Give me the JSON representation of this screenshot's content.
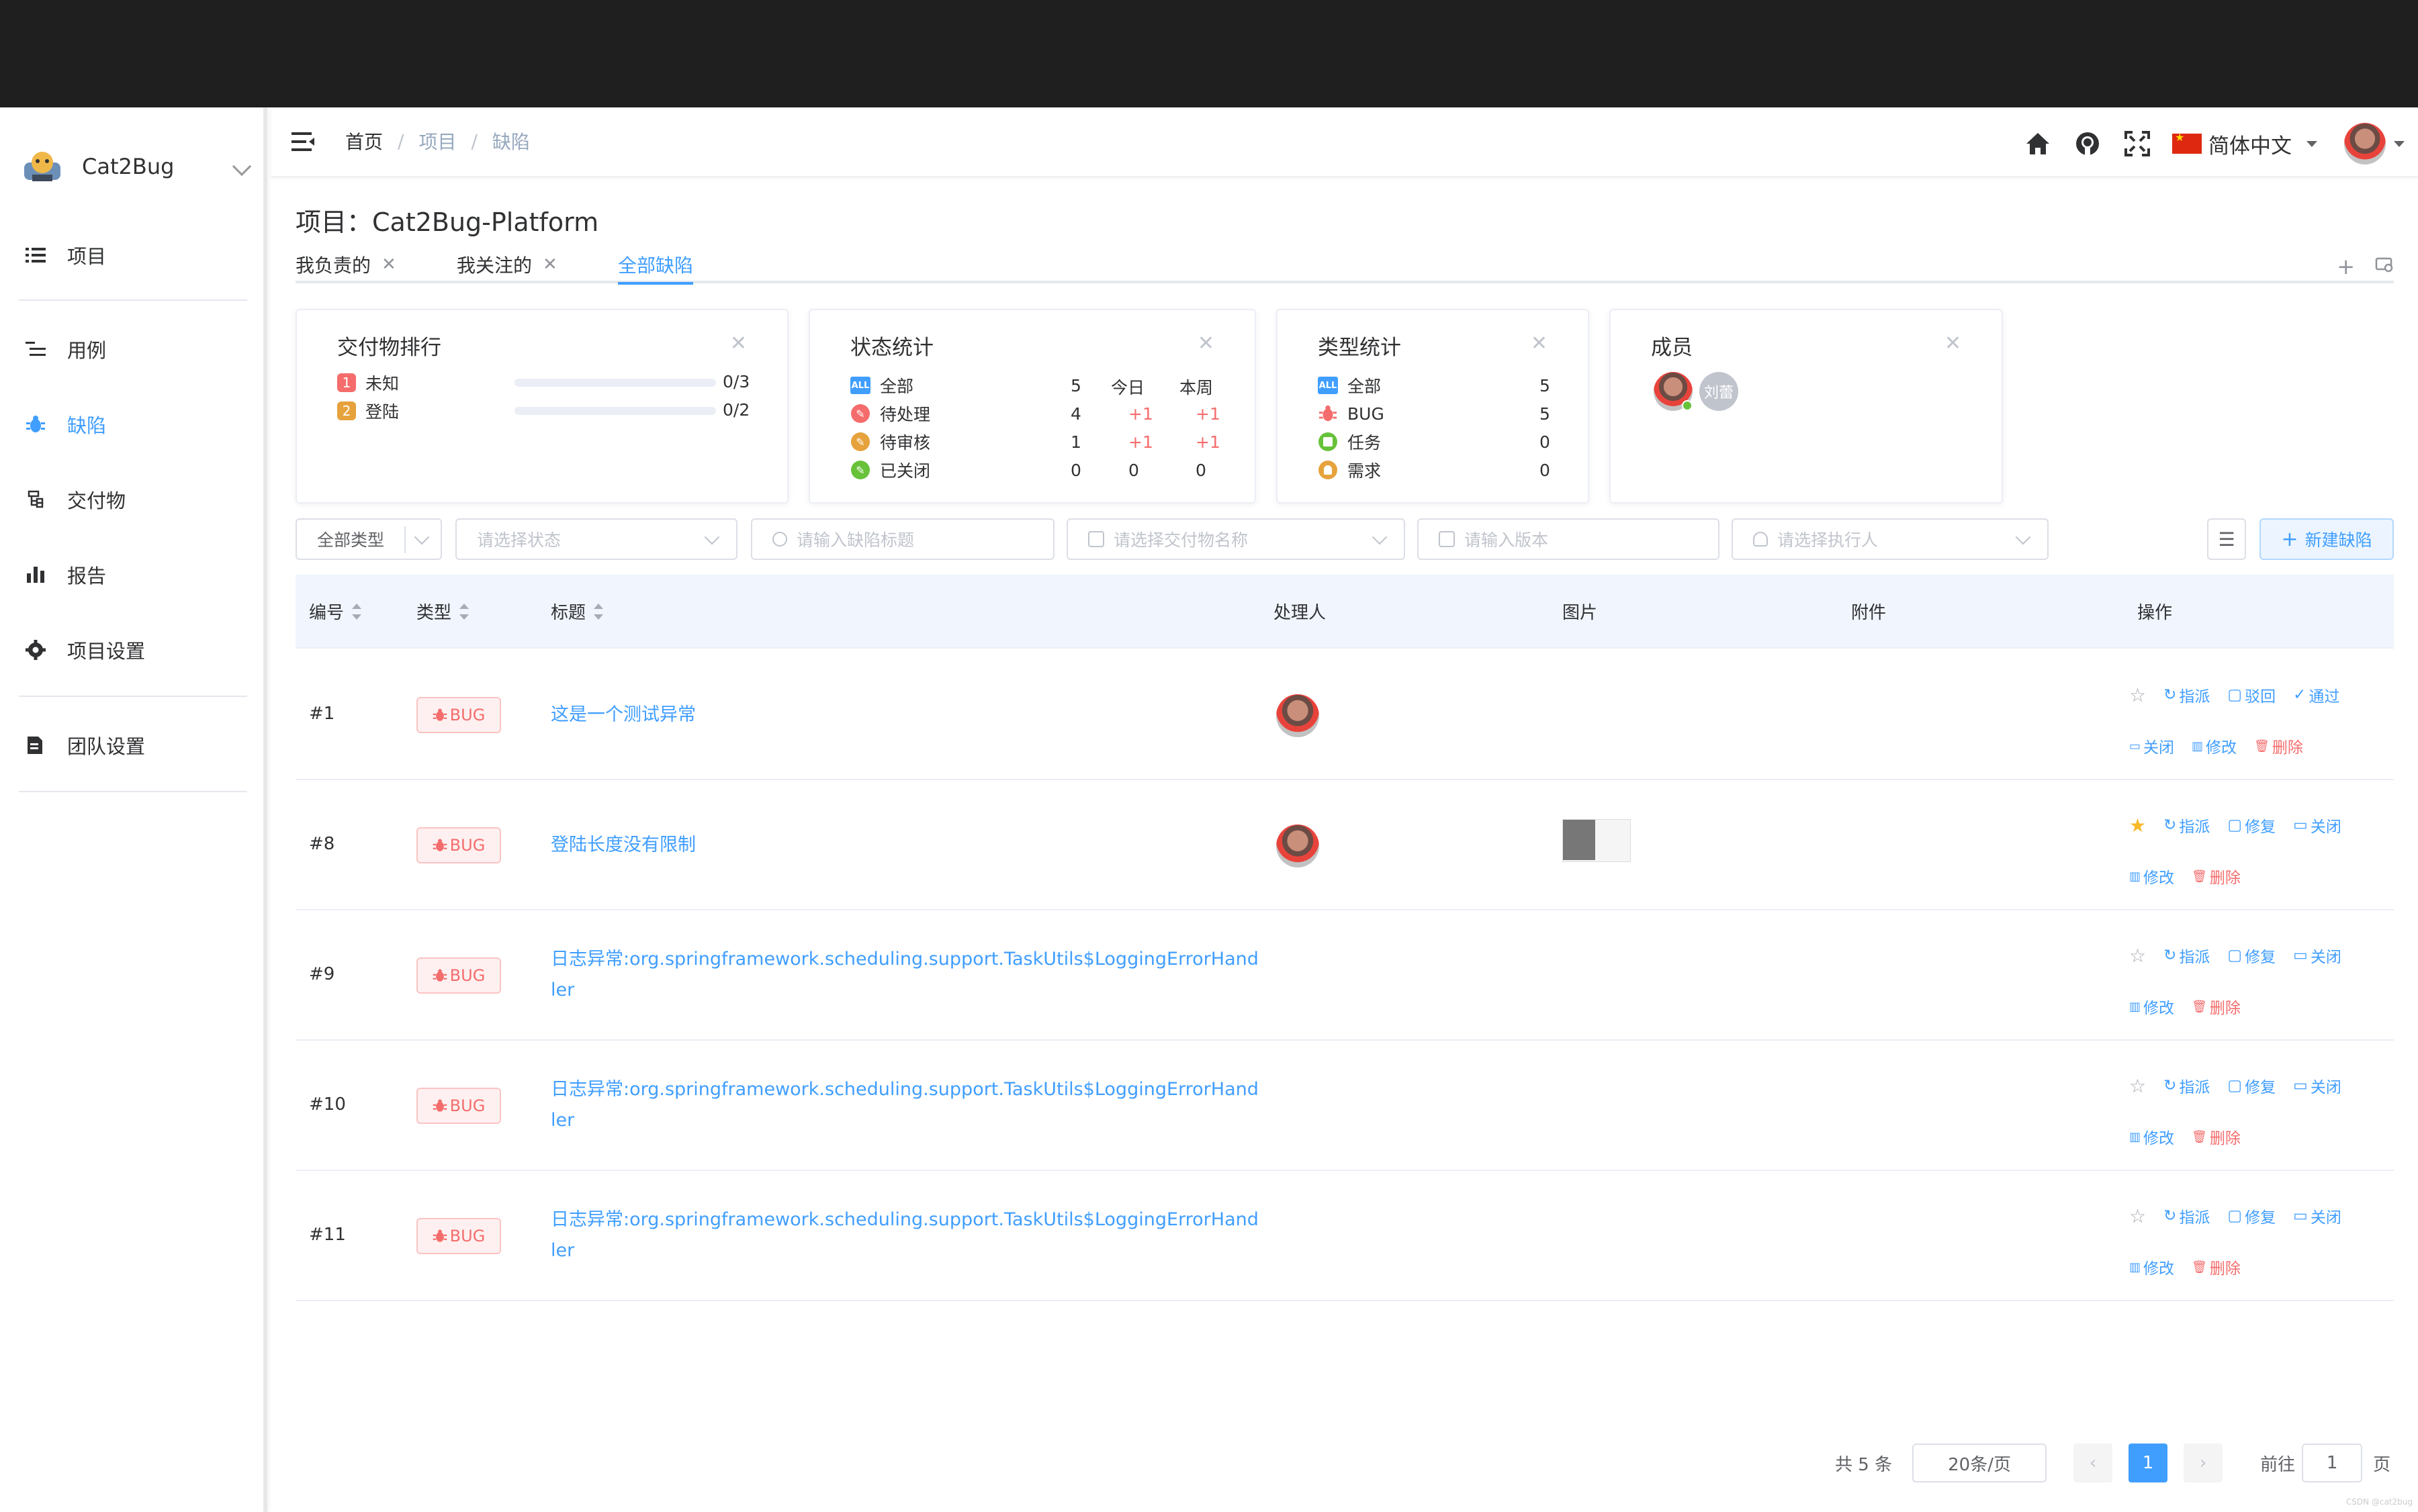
{
  "app": {
    "name": "Cat2Bug"
  },
  "sidebar": {
    "items": [
      {
        "label": "项目",
        "icon": "list-icon"
      },
      {
        "label": "用例",
        "icon": "list-tree-icon"
      },
      {
        "label": "缺陷",
        "icon": "bug-icon",
        "active": true
      },
      {
        "label": "交付物",
        "icon": "tree-icon"
      },
      {
        "label": "报告",
        "icon": "bar-chart-icon"
      },
      {
        "label": "项目设置",
        "icon": "gear-icon"
      },
      {
        "label": "团队设置",
        "icon": "document-icon"
      }
    ]
  },
  "breadcrumb": {
    "home": "首页",
    "project": "项目",
    "current": "缺陷"
  },
  "header": {
    "language": "简体中文"
  },
  "project": {
    "title": "项目：Cat2Bug-Platform"
  },
  "tabs": [
    {
      "label": "我负责的",
      "closable": true
    },
    {
      "label": "我关注的",
      "closable": true
    },
    {
      "label": "全部缺陷",
      "active": true
    }
  ],
  "cards": {
    "deliverables": {
      "title": "交付物排行",
      "rows": [
        {
          "rank": "1",
          "name": "未知",
          "value": "0/3",
          "fill": 0,
          "color": "#f56c6c"
        },
        {
          "rank": "2",
          "name": "登陆",
          "value": "0/2",
          "fill": 0,
          "color": "#e6a23c"
        }
      ]
    },
    "status": {
      "title": "状态统计",
      "columns": [
        "",
        "今日",
        "本周"
      ],
      "rows": [
        {
          "name": "全部",
          "total": "5",
          "today": "",
          "week": ""
        },
        {
          "name": "待处理",
          "total": "4",
          "today": "+1",
          "week": "+1"
        },
        {
          "name": "待审核",
          "total": "1",
          "today": "+1",
          "week": "+1"
        },
        {
          "name": "已关闭",
          "total": "0",
          "today": "0",
          "week": "0"
        }
      ]
    },
    "types": {
      "title": "类型统计",
      "rows": [
        {
          "name": "全部",
          "value": "5"
        },
        {
          "name": "BUG",
          "value": "5"
        },
        {
          "name": "任务",
          "value": "0"
        },
        {
          "name": "需求",
          "value": "0"
        }
      ]
    },
    "members": {
      "title": "成员",
      "second_member": "刘蕾"
    }
  },
  "filters": {
    "type": "全部类型",
    "status_placeholder": "请选择状态",
    "title_placeholder": "请输入缺陷标题",
    "deliverable_placeholder": "请选择交付物名称",
    "version_placeholder": "请输入版本",
    "assignee_placeholder": "请选择执行人",
    "new_button": "新建缺陷"
  },
  "table": {
    "headers": {
      "id": "编号",
      "type": "类型",
      "title": "标题",
      "handler": "处理人",
      "image": "图片",
      "attachment": "附件",
      "ops": "操作"
    },
    "rows": [
      {
        "id": "#1",
        "type": "BUG",
        "title": "这是一个测试异常",
        "handler": true,
        "image": false,
        "starred": false,
        "ops1": [
          "指派",
          "驳回",
          "通过"
        ],
        "ops2": [
          "关闭",
          "修改",
          "删除"
        ]
      },
      {
        "id": "#8",
        "type": "BUG",
        "title": "登陆长度没有限制",
        "handler": true,
        "image": true,
        "starred": true,
        "ops1": [
          "指派",
          "修复",
          "关闭"
        ],
        "ops2": [
          "修改",
          "删除"
        ]
      },
      {
        "id": "#9",
        "type": "BUG",
        "title": "日志异常:org.springframework.scheduling.support.TaskUtils$LoggingErrorHandler",
        "handler": false,
        "image": false,
        "starred": false,
        "ops1": [
          "指派",
          "修复",
          "关闭"
        ],
        "ops2": [
          "修改",
          "删除"
        ]
      },
      {
        "id": "#10",
        "type": "BUG",
        "title": "日志异常:org.springframework.scheduling.support.TaskUtils$LoggingErrorHandler",
        "handler": false,
        "image": false,
        "starred": false,
        "ops1": [
          "指派",
          "修复",
          "关闭"
        ],
        "ops2": [
          "修改",
          "删除"
        ]
      },
      {
        "id": "#11",
        "type": "BUG",
        "title": "日志异常:org.springframework.scheduling.support.TaskUtils$LoggingErrorHandler",
        "handler": false,
        "image": false,
        "starred": false,
        "ops1": [
          "指派",
          "修复",
          "关闭"
        ],
        "ops2": [
          "修改",
          "删除"
        ]
      }
    ]
  },
  "pagination": {
    "total": "共 5 条",
    "page_size": "20条/页",
    "current": "1",
    "goto_label": "前往",
    "goto_value": "1",
    "page_suffix": "页"
  },
  "footer": {
    "watermark": "CSDN @cat2bug"
  },
  "colors": {
    "primary": "#409eff",
    "danger": "#f56c6c",
    "warning": "#e6a23c",
    "success": "#67c23a"
  }
}
